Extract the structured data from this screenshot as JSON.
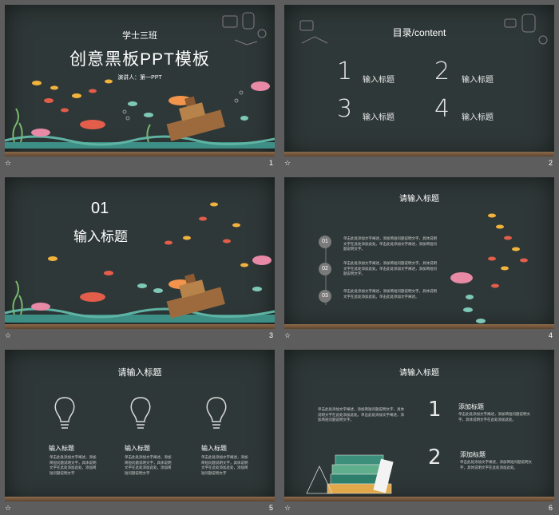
{
  "slides": [
    {
      "index": "1",
      "subtitle": "学士三班",
      "title": "创意黑板PPT模板",
      "presenter": "演讲人：第一PPT"
    },
    {
      "index": "2",
      "heading": "目录/content",
      "items": [
        {
          "num": "1",
          "label": "输入标题"
        },
        {
          "num": "2",
          "label": "输入标题"
        },
        {
          "num": "3",
          "label": "输入标题"
        },
        {
          "num": "4",
          "label": "输入标题"
        }
      ]
    },
    {
      "index": "3",
      "section_num": "01",
      "section_title": "输入标题"
    },
    {
      "index": "4",
      "heading": "请输入标题",
      "bullets": [
        {
          "num": "01",
          "text": "单击此处添加文字阐述，添加简短问题说明文字，具体说明文字在此处添加此处。单击此处添加文字阐述，添加简短问题说明文字。"
        },
        {
          "num": "02",
          "text": "单击此处添加文字阐述，添加简短问题说明文字，具体说明文字在此处添加此处。单击此处添加文字阐述，添加简短问题说明文字。"
        },
        {
          "num": "03",
          "text": "单击此处添加文字阐述，添加简短问题说明文字，具体说明文字在此处添加此处。单击此处添加文字阐述。"
        }
      ]
    },
    {
      "index": "5",
      "heading": "请输入标题",
      "columns": [
        {
          "label": "输入标题",
          "text": "单击此处添加文字阐述，添加简短问题说明文字，具体说明文字在此处添加此处，添加简短问题说明文字"
        },
        {
          "label": "输入标题",
          "text": "单击此处添加文字阐述，添加简短问题说明文字，具体说明文字在此处添加此处，添加简短问题说明文字"
        },
        {
          "label": "输入标题",
          "text": "单击此处添加文字阐述，添加简短问题说明文字，具体说明文字在此处添加此处，添加简短问题说明文字"
        }
      ]
    },
    {
      "index": "6",
      "heading": "请输入标题",
      "intro": "单击此处添加文字阐述，添加简短问题说明文字，具体说明文字在此处添加此处。单击此处添加文字阐述，添加简短问题说明文字。",
      "items": [
        {
          "num": "1",
          "label": "添加标题",
          "text": "单击此处添加文字阐述，添加简短问题说明文字，具体说明文字在此处添加此处。"
        },
        {
          "num": "2",
          "label": "添加标题",
          "text": "单击此处添加文字阐述，添加简短问题说明文字，具体说明文字在此处添加此处。"
        }
      ]
    }
  ],
  "star_glyph": "☆",
  "colors": {
    "chalkboard": "#2f3838",
    "frame": "#5d5d5d",
    "wood": "#8b6a4a"
  }
}
